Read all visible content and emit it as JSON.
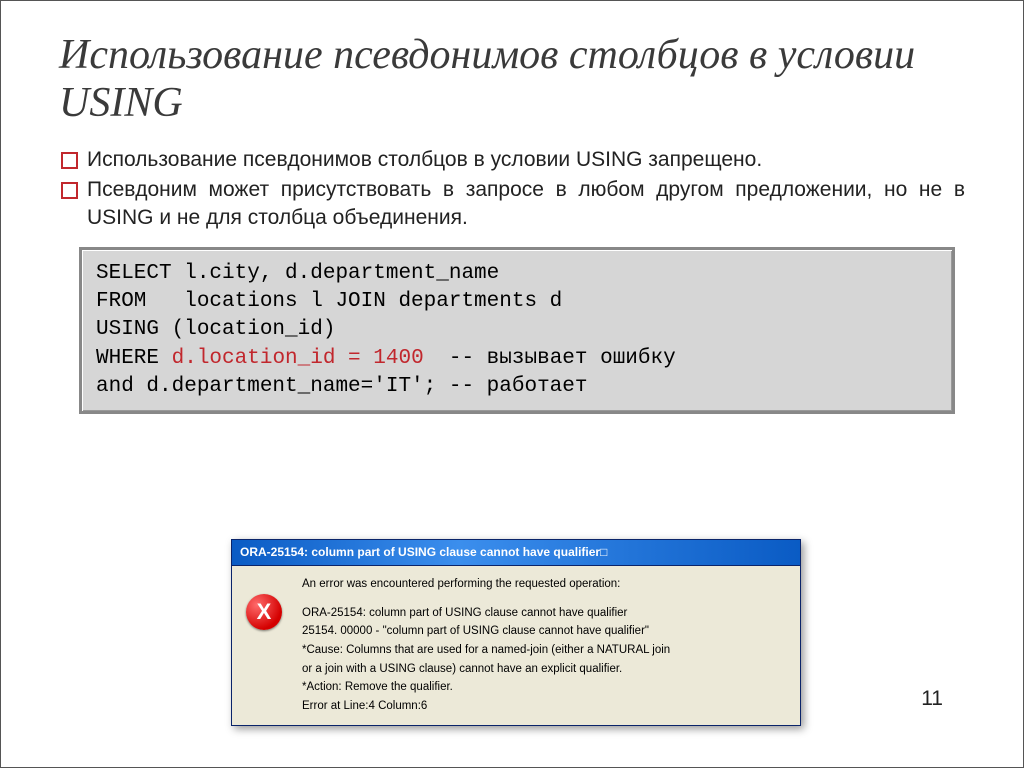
{
  "title": "Использование псевдонимов столбцов в условии USING",
  "bullets": [
    "Использование псевдонимов столбцов в условии USING запрещено.",
    "Псевдоним может присутствовать в запросе в любом другом предложении, но не в USING и не для столбца объединения."
  ],
  "code": {
    "l1": "SELECT l.city, d.department_name",
    "l2": "FROM   locations l JOIN departments d",
    "l3": "USING (location_id)",
    "l4a": "WHERE ",
    "l4b": "d.location_id = 1400",
    "l4c": "  -- вызывает ошибку",
    "l5": "and d.department_name='IT'; -- работает"
  },
  "dialog": {
    "title": "ORA-25154: column part of USING clause cannot have qualifier□",
    "icon_letter": "X",
    "line1": "An error was encountered performing the requested operation:",
    "line2": "ORA-25154: column part of USING clause cannot have qualifier",
    "line3": "25154. 00000 -  \"column part of USING clause cannot have qualifier\"",
    "line4": "*Cause:    Columns that are used for a named-join (either a NATURAL join",
    "line5": "           or a join with a USING clause) cannot have an explicit qualifier.",
    "line6": "*Action:   Remove the qualifier.",
    "line7": "Error at Line:4 Column:6"
  },
  "pagenum": "11"
}
